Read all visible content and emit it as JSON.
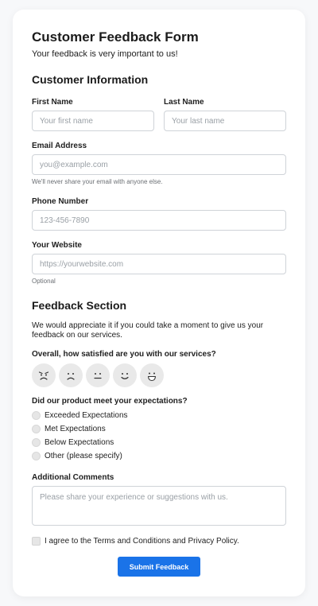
{
  "form": {
    "title": "Customer Feedback Form",
    "subtitle": "Your feedback is very important to us!"
  },
  "customer_info": {
    "heading": "Customer Information",
    "first_name": {
      "label": "First Name",
      "placeholder": "Your first name",
      "value": ""
    },
    "last_name": {
      "label": "Last Name",
      "placeholder": "Your last name",
      "value": ""
    },
    "email": {
      "label": "Email Address",
      "placeholder": "you@example.com",
      "value": "",
      "hint": "We'll never share your email with anyone else."
    },
    "phone": {
      "label": "Phone Number",
      "placeholder": "123-456-7890",
      "value": ""
    },
    "website": {
      "label": "Your Website",
      "placeholder": "https://yourwebsite.com",
      "value": "",
      "hint": "Optional"
    }
  },
  "feedback": {
    "heading": "Feedback Section",
    "intro": "We would appreciate it if you could take a moment to give us your feedback on our services.",
    "satisfaction_question": "Overall, how satisfied are you with our services?",
    "satisfaction_icons": [
      "angry-face-icon",
      "sad-face-icon",
      "neutral-face-icon",
      "smile-face-icon",
      "grin-face-icon"
    ],
    "expectations_question": "Did our product meet your expectations?",
    "expectation_options": [
      "Exceeded Expectations",
      "Met Expectations",
      "Below Expectations",
      "Other (please specify)"
    ],
    "comments": {
      "label": "Additional Comments",
      "placeholder": "Please share your experience or suggestions with us.",
      "value": ""
    }
  },
  "agreement": {
    "label": "I agree to the Terms and Conditions and Privacy Policy.",
    "checked": false
  },
  "submit_label": "Submit Feedback",
  "colors": {
    "accent": "#1a73e8",
    "face_bg": "#e9e9e9",
    "border": "#cfd3d8"
  }
}
